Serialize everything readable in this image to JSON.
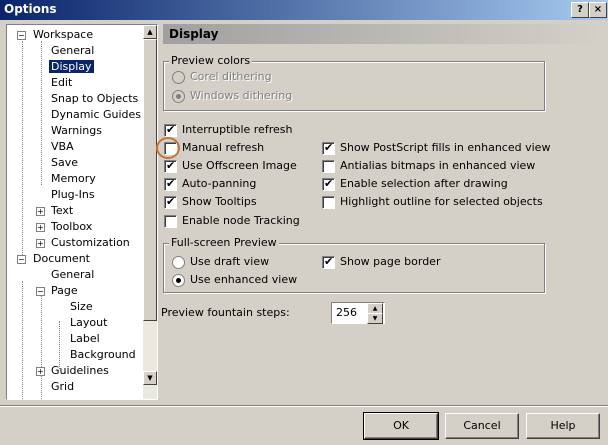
{
  "window": {
    "title": "Options"
  },
  "tree": {
    "nodes": [
      {
        "label": "Workspace",
        "expander": "−"
      },
      {
        "label": "General"
      },
      {
        "label": "Display",
        "selected": true
      },
      {
        "label": "Edit"
      },
      {
        "label": "Snap to Objects"
      },
      {
        "label": "Dynamic Guides"
      },
      {
        "label": "Warnings"
      },
      {
        "label": "VBA"
      },
      {
        "label": "Save"
      },
      {
        "label": "Memory"
      },
      {
        "label": "Plug-Ins"
      },
      {
        "label": "Text",
        "expander": "+"
      },
      {
        "label": "Toolbox",
        "expander": "+"
      },
      {
        "label": "Customization",
        "expander": "+"
      },
      {
        "label": "Document",
        "expander": "−"
      },
      {
        "label": "General"
      },
      {
        "label": "Page",
        "expander": "−"
      },
      {
        "label": "Size"
      },
      {
        "label": "Layout"
      },
      {
        "label": "Label"
      },
      {
        "label": "Background"
      },
      {
        "label": "Guidelines",
        "expander": "+"
      },
      {
        "label": "Grid"
      }
    ]
  },
  "page": {
    "title": "Display"
  },
  "preview_colors": {
    "label": "Preview colors",
    "corel": "Corel dithering",
    "windows": "Windows dithering"
  },
  "options": {
    "interruptible_refresh": "Interruptible refresh",
    "manual_refresh": "Manual refresh",
    "use_offscreen_image": "Use Offscreen Image",
    "auto_panning": "Auto-panning",
    "show_tooltips": "Show Tooltips",
    "enable_node_tracking": "Enable node Tracking",
    "show_postscript_fills": "Show PostScript fills in enhanced view",
    "antialias_bitmaps": "Antialias bitmaps in enhanced view",
    "enable_selection": "Enable selection after drawing",
    "highlight_outline": "Highlight outline for selected objects"
  },
  "fullscreen": {
    "label": "Full-screen Preview",
    "draft": "Use draft view",
    "enhanced": "Use enhanced view",
    "page_border": "Show page border"
  },
  "fountain": {
    "label": "Preview fountain steps:",
    "value": "256"
  },
  "buttons": {
    "ok": "OK",
    "cancel": "Cancel",
    "help": "Help"
  },
  "colors": {
    "title_start": "#0a246a",
    "selection": "#0a246a",
    "annotation": "#c87137"
  }
}
